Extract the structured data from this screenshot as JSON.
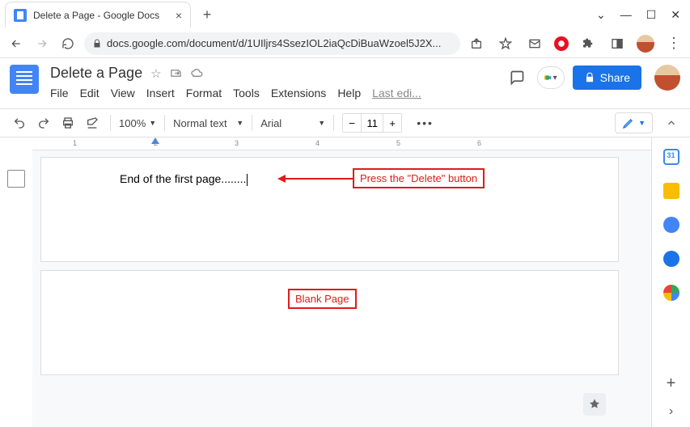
{
  "browser": {
    "tab_title": "Delete a Page - Google Docs",
    "url": "docs.google.com/document/d/1UIljrs4SsezIOL2iaQcDiBuaWzoel5J2X..."
  },
  "header": {
    "doc_title": "Delete a Page",
    "last_edit": "Last edi...",
    "share_label": "Share"
  },
  "menus": {
    "file": "File",
    "edit": "Edit",
    "view": "View",
    "insert": "Insert",
    "format": "Format",
    "tools": "Tools",
    "extensions": "Extensions",
    "help": "Help"
  },
  "toolbar": {
    "zoom": "100%",
    "style": "Normal text",
    "font": "Arial",
    "fontsize": "11"
  },
  "document": {
    "text": "End of the first page........"
  },
  "annotations": {
    "delete_hint": "Press the \"Delete\" button",
    "blank_page": "Blank Page"
  },
  "ruler": {
    "m1": "1",
    "m2": "2",
    "m3": "3",
    "m4": "4",
    "m5": "5",
    "m6": "6"
  }
}
